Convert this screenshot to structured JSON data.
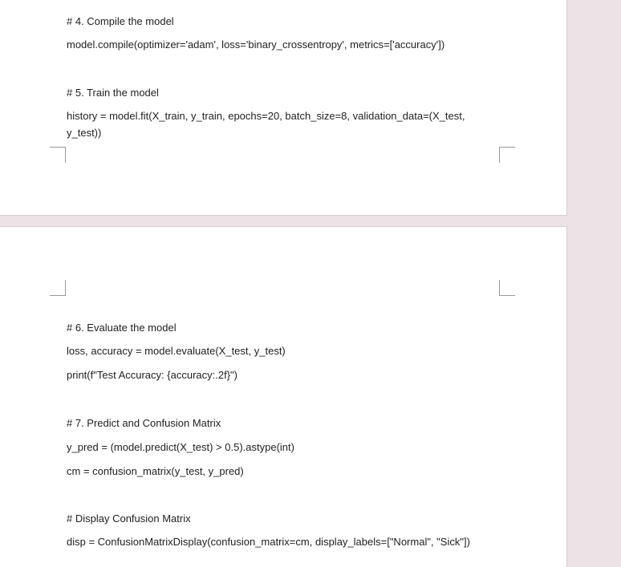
{
  "document": {
    "page1": {
      "lines": [
        "# 4. Compile the model",
        "model.compile(optimizer='adam', loss='binary_crossentropy', metrics=['accuracy'])",
        "# 5. Train the model",
        "history = model.fit(X_train, y_train, epochs=20, batch_size=8, validation_data=(X_test, y_test))"
      ]
    },
    "page2": {
      "lines": [
        "# 6. Evaluate the model",
        "loss, accuracy = model.evaluate(X_test, y_test)",
        "print(f\"Test Accuracy: {accuracy:.2f}\")",
        "# 7. Predict and Confusion Matrix",
        "y_pred = (model.predict(X_test) > 0.5).astype(int)",
        "cm = confusion_matrix(y_test, y_pred)",
        "# Display Confusion Matrix",
        "disp = ConfusionMatrixDisplay(confusion_matrix=cm, display_labels=[\"Normal\", \"Sick\"])"
      ]
    }
  }
}
